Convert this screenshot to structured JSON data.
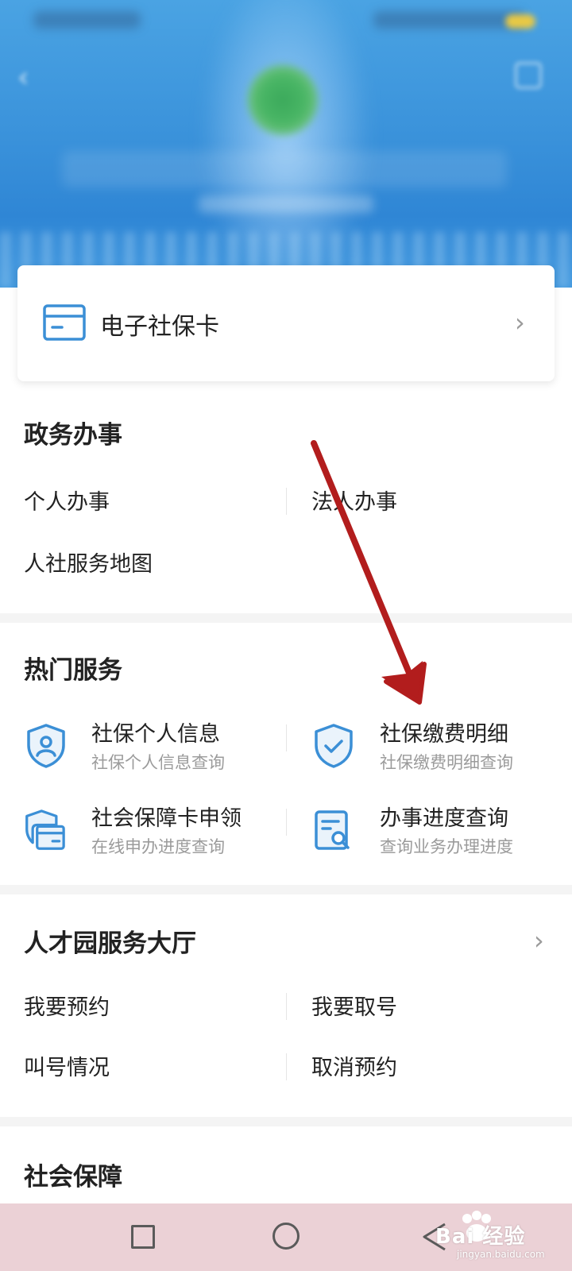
{
  "card": {
    "label": "电子社保卡",
    "icon": "card-icon"
  },
  "affairs": {
    "title": "政务办事",
    "items": [
      "个人办事",
      "法人办事",
      "人社服务地图"
    ]
  },
  "hot": {
    "title": "热门服务",
    "items": [
      {
        "title": "社保个人信息",
        "sub": "社保个人信息查询",
        "icon": "shield-person-icon"
      },
      {
        "title": "社保缴费明细",
        "sub": "社保缴费明细查询",
        "icon": "shield-check-icon"
      },
      {
        "title": "社会保障卡申领",
        "sub": "在线申办进度查询",
        "icon": "card-apply-icon"
      },
      {
        "title": "办事进度查询",
        "sub": "查询业务办理进度",
        "icon": "document-search-icon"
      }
    ]
  },
  "hall": {
    "title": "人才园服务大厅",
    "items": [
      "我要预约",
      "我要取号",
      "叫号情况",
      "取消预约"
    ]
  },
  "social": {
    "title": "社会保障"
  },
  "watermark": {
    "brand": "Bai 经验",
    "url": "jingyan.baidu.com"
  },
  "colors": {
    "accent": "#3b8fd6",
    "arrow": "#b21d1d",
    "navbar": "#ebd1d6"
  }
}
